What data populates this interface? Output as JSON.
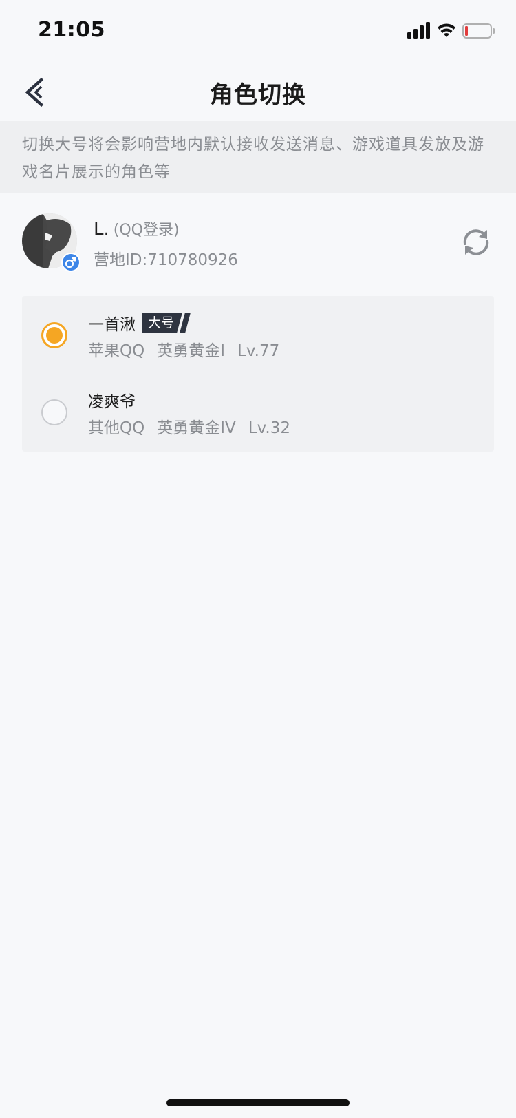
{
  "status_bar": {
    "time": "21:05",
    "icons": [
      "signal-icon",
      "wifi-icon",
      "battery-icon"
    ],
    "battery_color": "#e23c3c"
  },
  "header": {
    "title": "角色切换",
    "back_icon": "chevron-left-icon"
  },
  "notice": {
    "text_line1": "切换大号将会影响营地内默认接收发送消息、游戏道具发放及游",
    "text_line2": "戏名片展示的角色等"
  },
  "account": {
    "name": "L.",
    "login_type": "(QQ登录)",
    "camp_id": "营地ID:710780926",
    "gender_icon": "male-icon",
    "gender_color": "#3d86e8",
    "refresh_icon": "refresh-icon"
  },
  "roles": [
    {
      "name": "一首湫",
      "tag": "大号",
      "platform": "苹果QQ",
      "rank": "英勇黄金I",
      "level": "Lv.77",
      "selected": true
    },
    {
      "name": "凌爽爷",
      "tag": "",
      "platform": "其他QQ",
      "rank": "英勇黄金IV",
      "level": "Lv.32",
      "selected": false
    }
  ],
  "colors": {
    "accent": "#f5a623",
    "tag_bg": "#2e3440",
    "secondary_text": "#8a8d92"
  }
}
